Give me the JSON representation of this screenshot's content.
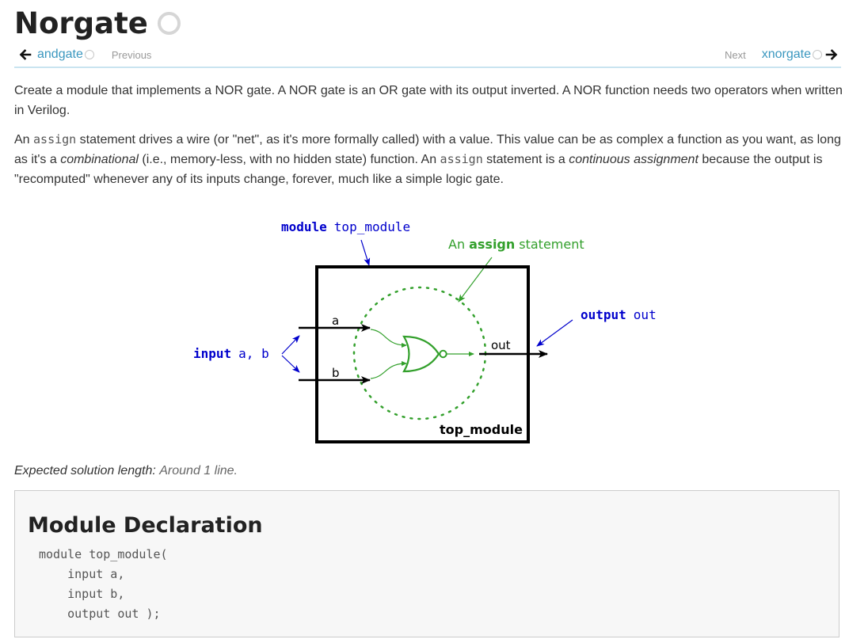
{
  "page": {
    "title": "Norgate"
  },
  "nav": {
    "prev_link": "andgate",
    "prev_label": "Previous",
    "next_label": "Next",
    "next_link": "xnorgate"
  },
  "content": {
    "p1": "Create a module that implements a NOR gate. A NOR gate is an OR gate with its output inverted. A NOR function needs two operators when written in Verilog.",
    "p2_a": "An ",
    "p2_code1": "assign",
    "p2_b": " statement drives a wire (or \"net\", as it's more formally called) with a value. This value can be as complex a function as you want, as long as it's a ",
    "p2_em1": "combinational",
    "p2_c": " (i.e., memory-less, with no hidden state) function. An ",
    "p2_code2": "assign",
    "p2_d": " statement is a ",
    "p2_em2": "continuous assignment",
    "p2_e": " because the output is \"recomputed\" whenever any of its inputs change, forever, much like a simple logic gate."
  },
  "diagram": {
    "module_keyword": "module",
    "module_name": "top_module",
    "assign_prefix": "An",
    "assign_keyword": "assign",
    "assign_suffix": "statement",
    "output_keyword": "output",
    "output_name": "out",
    "input_keyword": "input",
    "input_names": "a, b",
    "wire_a": "a",
    "wire_b": "b",
    "wire_out": "out",
    "box_label": "top_module",
    "colors": {
      "keyword_blue": "#0000cc",
      "assign_green": "#33a02c",
      "box": "#000000"
    }
  },
  "expected": {
    "label": "Expected solution length:",
    "value": "Around 1 line."
  },
  "declaration": {
    "title": "Module Declaration",
    "code": "module top_module(\n    input a,\n    input b,\n    output out );"
  }
}
